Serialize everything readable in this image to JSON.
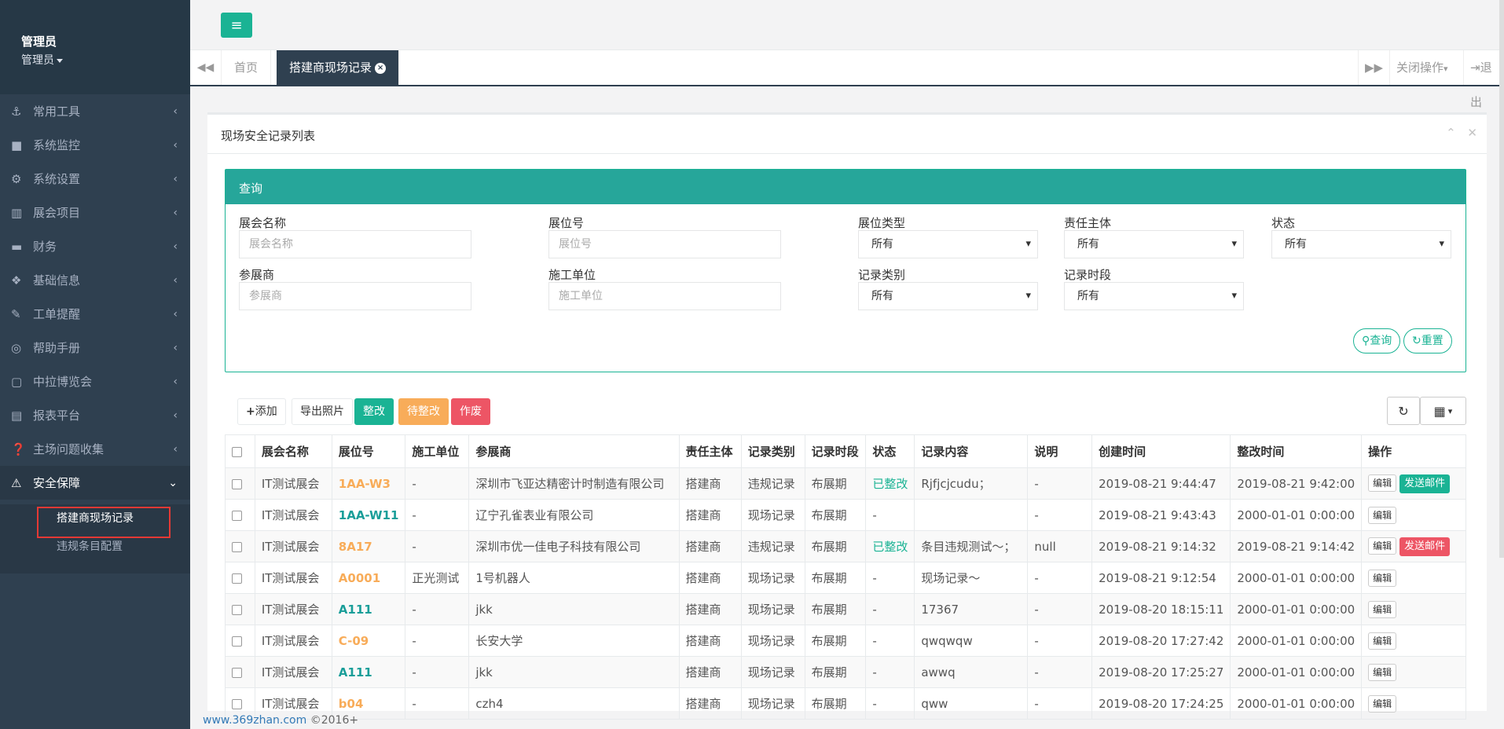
{
  "sidebar": {
    "user_name": "管理员",
    "user_role": "管理员",
    "items": [
      {
        "icon": "anchor-icon",
        "glyph": "⚓",
        "label": "常用工具"
      },
      {
        "icon": "video-icon",
        "glyph": "■",
        "label": "系统监控"
      },
      {
        "icon": "gear-icon",
        "glyph": "⚙",
        "label": "系统设置"
      },
      {
        "icon": "map-icon",
        "glyph": "▥",
        "label": "展会项目"
      },
      {
        "icon": "credit-card-icon",
        "glyph": "▬",
        "label": "财务"
      },
      {
        "icon": "cubes-icon",
        "glyph": "❖",
        "label": "基础信息"
      },
      {
        "icon": "edit-icon",
        "glyph": "✎",
        "label": "工单提醒"
      },
      {
        "icon": "life-ring-icon",
        "glyph": "◎",
        "label": "帮助手册"
      },
      {
        "icon": "copy-icon",
        "glyph": "▢",
        "label": "中拉博览会"
      },
      {
        "icon": "report-icon",
        "glyph": "▤",
        "label": "报表平台"
      },
      {
        "icon": "question-icon",
        "glyph": "❓",
        "label": "主场问题收集"
      }
    ],
    "active_item": {
      "icon": "warning-icon",
      "glyph": "⚠",
      "label": "安全保障"
    },
    "sub_items": [
      "搭建商现场记录",
      "违规条目配置"
    ]
  },
  "tabs": {
    "home": "首页",
    "current": "搭建商现场记录",
    "close_ops": "关闭操作",
    "logout": "退出"
  },
  "panel": {
    "title": "现场安全记录列表",
    "query": {
      "heading": "查询",
      "exhibition_label": "展会名称",
      "exhibition_placeholder": "展会名称",
      "booth_label": "展位号",
      "booth_placeholder": "展位号",
      "booth_type_label": "展位类型",
      "booth_type_value": "所有",
      "responsible_label": "责任主体",
      "responsible_value": "所有",
      "status_label": "状态",
      "status_value": "所有",
      "exhibitor_label": "参展商",
      "exhibitor_placeholder": "参展商",
      "builder_label": "施工单位",
      "builder_placeholder": "施工单位",
      "record_type_label": "记录类别",
      "record_type_value": "所有",
      "record_period_label": "记录时段",
      "record_period_value": "所有",
      "search_btn": "查询",
      "reset_btn": "重置"
    },
    "toolbar": {
      "add": "添加",
      "export_photos": "导出照片",
      "rectify": "整改",
      "pending": "待整改",
      "void": "作废"
    },
    "table": {
      "headers": [
        "展会名称",
        "展位号",
        "施工单位",
        "参展商",
        "责任主体",
        "记录类别",
        "记录时段",
        "状态",
        "记录内容",
        "说明",
        "创建时间",
        "整改时间",
        "操作"
      ],
      "edit_label": "编辑",
      "mail_label": "发送邮件",
      "rows": [
        {
          "expo": "IT测试展会",
          "booth": "1AA-W3",
          "booth_color": "orange",
          "builder": "-",
          "exhibitor": "深圳市飞亚达精密计时制造有限公司",
          "resp": "搭建商",
          "rtype": "违规记录",
          "period": "布展期",
          "status": "已整改",
          "content": "Rjfjcjcudu；",
          "note": "-",
          "created": "2019-08-21 9:44:47",
          "fixed": "2019-08-21 9:42:00",
          "mail": "teal"
        },
        {
          "expo": "IT测试展会",
          "booth": "1AA-W11",
          "booth_color": "teal",
          "builder": "-",
          "exhibitor": "辽宁孔雀表业有限公司",
          "resp": "搭建商",
          "rtype": "现场记录",
          "period": "布展期",
          "status": "-",
          "content": "",
          "note": "-",
          "created": "2019-08-21 9:43:43",
          "fixed": "2000-01-01 0:00:00",
          "mail": ""
        },
        {
          "expo": "IT测试展会",
          "booth": "8A17",
          "booth_color": "orange",
          "builder": "-",
          "exhibitor": "深圳市优一佳电子科技有限公司",
          "resp": "搭建商",
          "rtype": "违规记录",
          "period": "布展期",
          "status": "已整改",
          "content": "条目违规测试～；",
          "note": "null",
          "created": "2019-08-21 9:14:32",
          "fixed": "2019-08-21 9:14:42",
          "mail": "red"
        },
        {
          "expo": "IT测试展会",
          "booth": "A0001",
          "booth_color": "orange",
          "builder": "正光测试",
          "exhibitor": "1号机器人",
          "resp": "搭建商",
          "rtype": "现场记录",
          "period": "布展期",
          "status": "-",
          "content": "现场记录～",
          "note": "-",
          "created": "2019-08-21 9:12:54",
          "fixed": "2000-01-01 0:00:00",
          "mail": ""
        },
        {
          "expo": "IT测试展会",
          "booth": "A111",
          "booth_color": "teal",
          "builder": "-",
          "exhibitor": "jkk",
          "resp": "搭建商",
          "rtype": "现场记录",
          "period": "布展期",
          "status": "-",
          "content": "17367",
          "note": "-",
          "created": "2019-08-20 18:15:11",
          "fixed": "2000-01-01 0:00:00",
          "mail": ""
        },
        {
          "expo": "IT测试展会",
          "booth": "C-09",
          "booth_color": "orange",
          "builder": "-",
          "exhibitor": "长安大学",
          "resp": "搭建商",
          "rtype": "现场记录",
          "period": "布展期",
          "status": "-",
          "content": "qwqwqw",
          "note": "-",
          "created": "2019-08-20 17:27:42",
          "fixed": "2000-01-01 0:00:00",
          "mail": ""
        },
        {
          "expo": "IT测试展会",
          "booth": "A111",
          "booth_color": "teal",
          "builder": "-",
          "exhibitor": "jkk",
          "resp": "搭建商",
          "rtype": "现场记录",
          "period": "布展期",
          "status": "-",
          "content": "awwq",
          "note": "-",
          "created": "2019-08-20 17:25:27",
          "fixed": "2000-01-01 0:00:00",
          "mail": ""
        },
        {
          "expo": "IT测试展会",
          "booth": "b04",
          "booth_color": "orange",
          "builder": "-",
          "exhibitor": "czh4",
          "resp": "搭建商",
          "rtype": "现场记录",
          "period": "布展期",
          "status": "-",
          "content": "qww",
          "note": "-",
          "created": "2019-08-20 17:24:25",
          "fixed": "2000-01-01 0:00:00",
          "mail": ""
        }
      ]
    }
  },
  "footer": {
    "link": "www.369zhan.com",
    "copyright": "©2016+"
  }
}
